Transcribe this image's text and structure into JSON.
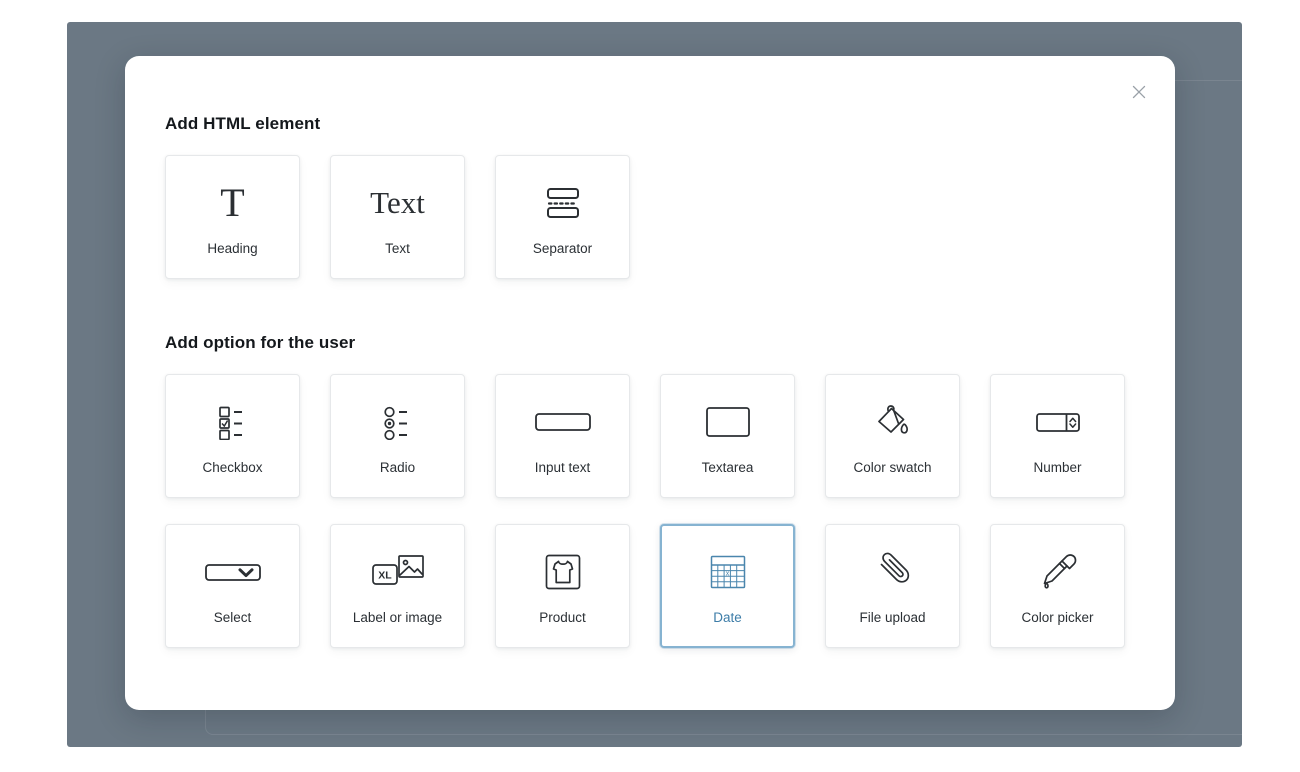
{
  "dialog": {
    "close_label": "×",
    "close_icon": "close-icon"
  },
  "sections": [
    {
      "title": "Add HTML element",
      "items": [
        {
          "label": "Heading",
          "icon": "heading-T-icon",
          "selected": false
        },
        {
          "label": "Text",
          "icon": "text-serif-icon",
          "selected": false
        },
        {
          "label": "Separator",
          "icon": "separator-icon",
          "selected": false
        }
      ]
    },
    {
      "title": "Add option for the user",
      "items": [
        {
          "label": "Checkbox",
          "icon": "checkbox-list-icon",
          "selected": false
        },
        {
          "label": "Radio",
          "icon": "radio-list-icon",
          "selected": false
        },
        {
          "label": "Input text",
          "icon": "input-text-icon",
          "selected": false
        },
        {
          "label": "Textarea",
          "icon": "textarea-icon",
          "selected": false
        },
        {
          "label": "Color swatch",
          "icon": "paint-bucket-icon",
          "selected": false
        },
        {
          "label": "Number",
          "icon": "number-stepper-icon",
          "selected": false
        },
        {
          "label": "Select",
          "icon": "select-dropdown-icon",
          "selected": false
        },
        {
          "label": "Label or image",
          "icon": "label-image-icon",
          "selected": false
        },
        {
          "label": "Product",
          "icon": "tshirt-icon",
          "selected": false
        },
        {
          "label": "Date",
          "icon": "calendar-icon",
          "selected": true
        },
        {
          "label": "File upload",
          "icon": "paperclip-icon",
          "selected": false
        },
        {
          "label": "Color picker",
          "icon": "eyedropper-icon",
          "selected": false
        }
      ]
    }
  ],
  "glyphs": {
    "heading": "T",
    "text": "Text",
    "size_chip": "XL",
    "date_mark": "x"
  },
  "colors": {
    "backdrop": "#6b7884",
    "dialog": "#ffffff",
    "card_border": "#e6e8ea",
    "selected_border": "#86b3d1",
    "selected_text": "#3d7da8",
    "selected_icon": "#4a86ad",
    "title_text": "#14181c",
    "label_text": "#2b3035",
    "close_icon": "#9aa1a8"
  }
}
